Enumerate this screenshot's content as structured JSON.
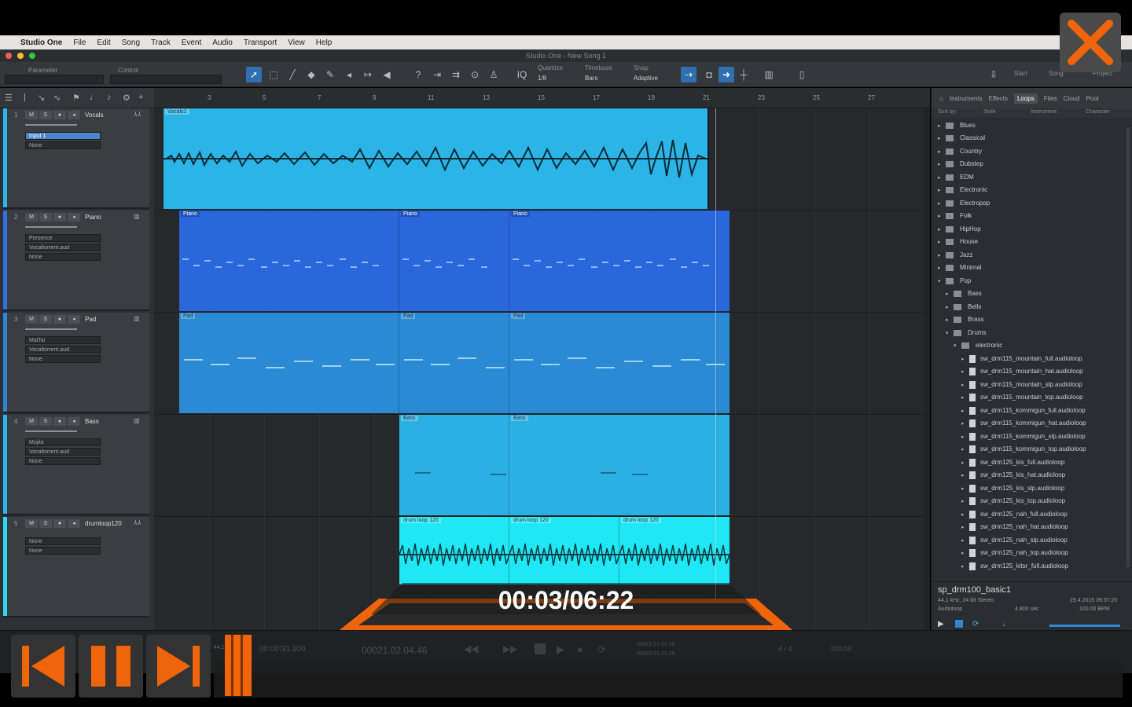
{
  "menubar": {
    "app": "Studio One",
    "items": [
      "File",
      "Edit",
      "Song",
      "Track",
      "Event",
      "Audio",
      "Transport",
      "View",
      "Help"
    ]
  },
  "window": {
    "title": "Studio One - New Song 1"
  },
  "toolbar": {
    "parameter_label": "Parameter",
    "control_label": "Control",
    "quantize_label": "Quantize",
    "quantize_value": "1/8",
    "timebase_label": "Timebase",
    "timebase_value": "Bars",
    "snap_label": "Snap",
    "snap_value": "Adaptive",
    "start_label": "Start",
    "song_label": "Song",
    "project_label": "Project"
  },
  "ruler": {
    "ticks": [
      "3",
      "5",
      "7",
      "9",
      "11",
      "13",
      "15",
      "17",
      "19",
      "21",
      "23",
      "25",
      "27"
    ]
  },
  "tracks": [
    {
      "num": "1",
      "name": "Vocals",
      "slots": [
        "Input 1",
        "None"
      ],
      "color": "#2fb6e8"
    },
    {
      "num": "2",
      "name": "Piano",
      "slots": [
        "Presence",
        "Vocaltorrent.aud",
        "None"
      ],
      "color": "#2f6fe0"
    },
    {
      "num": "3",
      "name": "Pad",
      "slots": [
        "MaiTai",
        "Vocaltorrent.aud",
        "None"
      ],
      "color": "#2f86d0"
    },
    {
      "num": "4",
      "name": "Bass",
      "slots": [
        "Mojito",
        "Vocaltorrent.aud",
        "None"
      ],
      "color": "#2fb6e8"
    },
    {
      "num": "5",
      "name": "drumloop120",
      "slots": [
        "None",
        "None"
      ],
      "color": "#2fd8f0"
    }
  ],
  "clips": {
    "vocals": "Vocals1",
    "piano": [
      "Piano",
      "Piano",
      "Piano"
    ],
    "pad": [
      "Pad",
      "Pad",
      "Pad"
    ],
    "bass": [
      "Bass",
      "Bass"
    ],
    "drums": [
      "drum loop 120",
      "drum loop 120",
      "drum loop 120"
    ]
  },
  "browser": {
    "tabs": [
      "Instruments",
      "Effects",
      "Loops",
      "Files",
      "Cloud",
      "Pool"
    ],
    "active_tab": "Loops",
    "sort_by": "Sort by:",
    "sort_options": [
      "Style",
      "Instrument",
      "Character"
    ],
    "folders": [
      "Blues",
      "Classical",
      "Country",
      "Dubstep",
      "EDM",
      "Electronic",
      "Electropop",
      "Folk",
      "HipHop",
      "House",
      "Jazz",
      "Minimal",
      "Pop"
    ],
    "pop_children": [
      "Bass",
      "Bells",
      "Brass",
      "Drums"
    ],
    "subfolder": "electronic",
    "files": [
      "sw_drm115_mountain_full.audioloop",
      "sw_drm115_mountain_hat.audioloop",
      "sw_drm115_mountain_slp.audioloop",
      "sw_drm115_mountain_top.audioloop",
      "sw_drm115_kommigun_full.audioloop",
      "sw_drm115_kommigun_hat.audioloop",
      "sw_drm115_kommigun_slp.audioloop",
      "sw_drm115_kommigun_top.audioloop",
      "sw_drm125_kis_full.audioloop",
      "sw_drm125_kis_hat.audioloop",
      "sw_drm125_kis_slp.audioloop",
      "sw_drm125_kis_top.audioloop",
      "sw_drm125_nah_full.audioloop",
      "sw_drm125_nah_hat.audioloop",
      "sw_drm125_nah_slp.audioloop",
      "sw_drm125_nah_top.audioloop",
      "sw_drm125_kitsr_full.audioloop"
    ],
    "info": {
      "file": "sp_drm100_basic1",
      "format": "44.1 kHz, 24 bit Stereo",
      "type": "Audioloop",
      "length": "4.800 sec",
      "date": "29.4.2015 09:37:20",
      "tempo": "100.00 BPM"
    }
  },
  "transport": {
    "sample_rate": "44.1 kHz",
    "position": "00:00:31.100",
    "bars": "00021.02.04.46",
    "l_marker": "00021.01.01.00",
    "r_marker": "00029.01.01.00",
    "time_sig": "4 / 4",
    "tempo": "100.00"
  },
  "player": {
    "current": "00:03",
    "total": "06:22",
    "timecode": "00:03/06:22",
    "accent": "#f0640a"
  }
}
